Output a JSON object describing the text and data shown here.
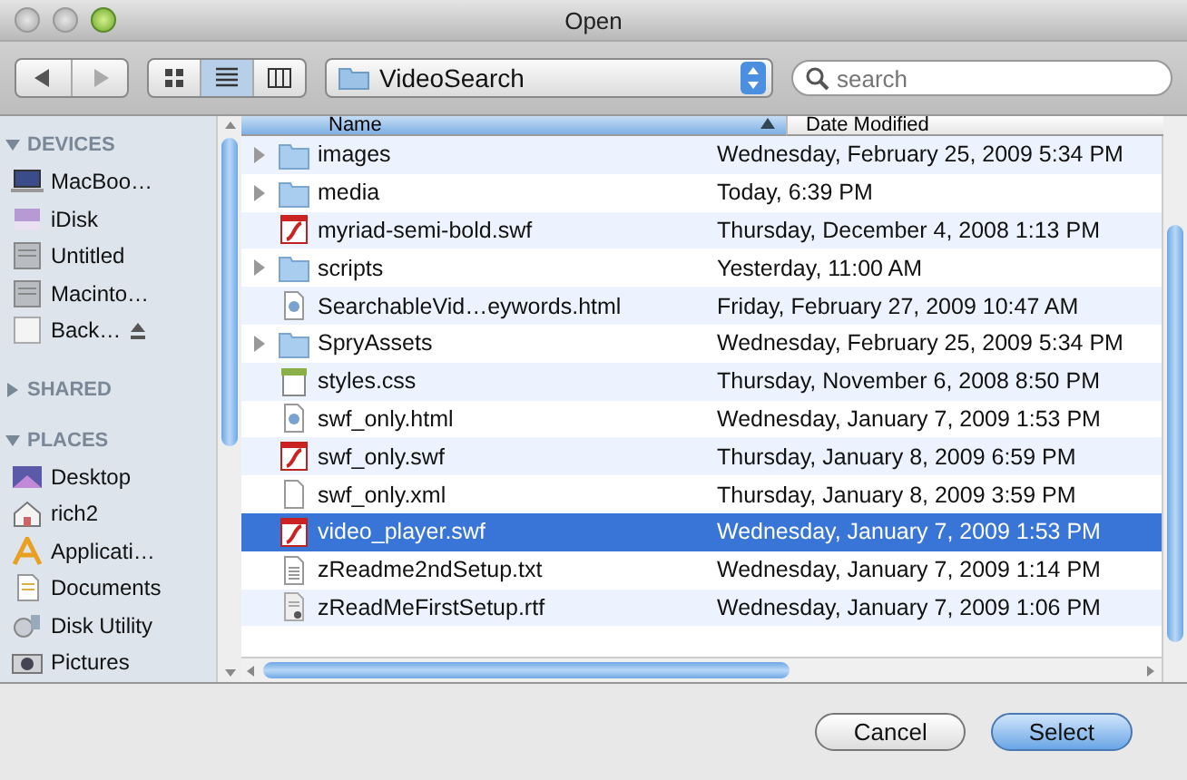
{
  "window": {
    "title": "Open"
  },
  "toolbar": {
    "view_modes": [
      {
        "kind": "icons",
        "selected": false
      },
      {
        "kind": "list",
        "selected": true
      },
      {
        "kind": "columns",
        "selected": false
      }
    ],
    "location": "VideoSearch",
    "search": {
      "placeholder": "search"
    }
  },
  "sidebar": {
    "sections": [
      {
        "label": "DEVICES",
        "expanded": true,
        "items": [
          {
            "label": "MacBoo…",
            "kind": "laptop"
          },
          {
            "label": "iDisk",
            "kind": "idisk"
          },
          {
            "label": "Untitled",
            "kind": "drive"
          },
          {
            "label": "Macinto…",
            "kind": "drive"
          },
          {
            "label": "Back…",
            "kind": "backup",
            "eject": true
          }
        ]
      },
      {
        "label": "SHARED",
        "expanded": false
      },
      {
        "label": "PLACES",
        "expanded": true,
        "items": [
          {
            "label": "Desktop",
            "kind": "desktop"
          },
          {
            "label": "rich2",
            "kind": "home"
          },
          {
            "label": "Applicati…",
            "kind": "apps"
          },
          {
            "label": "Documents",
            "kind": "documents"
          },
          {
            "label": "Disk Utility",
            "kind": "utility"
          },
          {
            "label": "Pictures",
            "kind": "pictures"
          }
        ]
      }
    ]
  },
  "table": {
    "columns": [
      {
        "label": "Name",
        "sorted": true
      },
      {
        "label": "Date Modified",
        "sorted": false
      }
    ],
    "rows": [
      {
        "name": "images",
        "date": "Wednesday, February 25, 2009 5:34 PM",
        "kind": "folder",
        "selected": false
      },
      {
        "name": "media",
        "date": "Today, 6:39 PM",
        "kind": "folder",
        "selected": false
      },
      {
        "name": "myriad-semi-bold.swf",
        "date": "Thursday, December 4, 2008 1:13 PM",
        "kind": "swf",
        "selected": false
      },
      {
        "name": "scripts",
        "date": "Yesterday, 11:00 AM",
        "kind": "folder",
        "selected": false
      },
      {
        "name": "SearchableVid…eywords.html",
        "date": "Friday, February 27, 2009 10:47 AM",
        "kind": "html",
        "selected": false
      },
      {
        "name": "SpryAssets",
        "date": "Wednesday, February 25, 2009 5:34 PM",
        "kind": "folder",
        "selected": false
      },
      {
        "name": "styles.css",
        "date": "Thursday, November 6, 2008 8:50 PM",
        "kind": "css",
        "selected": false
      },
      {
        "name": "swf_only.html",
        "date": "Wednesday, January 7, 2009 1:53 PM",
        "kind": "html",
        "selected": false
      },
      {
        "name": "swf_only.swf",
        "date": "Thursday, January 8, 2009 6:59 PM",
        "kind": "swf",
        "selected": false
      },
      {
        "name": "swf_only.xml",
        "date": "Thursday, January 8, 2009 3:59 PM",
        "kind": "blank",
        "selected": false
      },
      {
        "name": "video_player.swf",
        "date": "Wednesday, January 7, 2009 1:53 PM",
        "kind": "swf",
        "selected": true
      },
      {
        "name": "zReadme2ndSetup.txt",
        "date": "Wednesday, January 7, 2009 1:14 PM",
        "kind": "text",
        "selected": false
      },
      {
        "name": "zReadMeFirstSetup.rtf",
        "date": "Wednesday, January 7, 2009 1:06 PM",
        "kind": "rtf",
        "selected": false
      }
    ]
  },
  "buttons": [
    {
      "label": "Cancel",
      "default": false
    },
    {
      "label": "Select",
      "default": true
    }
  ]
}
